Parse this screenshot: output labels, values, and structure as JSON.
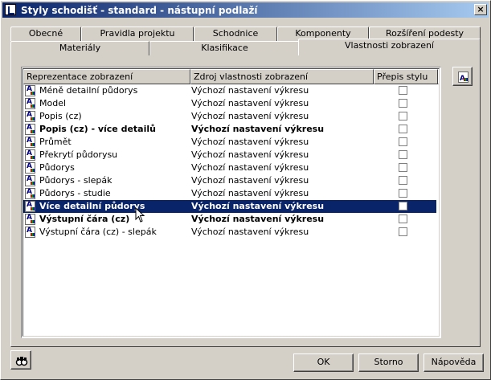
{
  "window": {
    "title": "Styly schodišť - standard - nástupní podlaží",
    "close_glyph": "×"
  },
  "tabs_back": [
    "Obecné",
    "Pravidla projektu",
    "Schodnice",
    "Komponenty",
    "Rozšíření podesty"
  ],
  "tabs_front": [
    "Materiály",
    "Klasifikace",
    "Vlastnosti zobrazení"
  ],
  "active_tab": "Vlastnosti zobrazení",
  "table": {
    "headers": [
      "Reprezentace zobrazení",
      "Zdroj vlastnosti zobrazení",
      "Přepis stylu"
    ],
    "rows": [
      {
        "name": "Méně detailní půdorys",
        "source": "Výchozí nastavení výkresu",
        "bold": false,
        "selected": false
      },
      {
        "name": "Model",
        "source": "Výchozí nastavení výkresu",
        "bold": false,
        "selected": false
      },
      {
        "name": "Popis (cz)",
        "source": "Výchozí nastavení výkresu",
        "bold": false,
        "selected": false
      },
      {
        "name": "Popis (cz) - více detailů",
        "source": "Výchozí nastavení výkresu",
        "bold": true,
        "selected": false
      },
      {
        "name": "Průmět",
        "source": "Výchozí nastavení výkresu",
        "bold": false,
        "selected": false
      },
      {
        "name": "Překrytí půdorysu",
        "source": "Výchozí nastavení výkresu",
        "bold": false,
        "selected": false
      },
      {
        "name": "Půdorys",
        "source": "Výchozí nastavení výkresu",
        "bold": false,
        "selected": false
      },
      {
        "name": "Půdorys - slepák",
        "source": "Výchozí nastavení výkresu",
        "bold": false,
        "selected": false
      },
      {
        "name": "Půdorys - studie",
        "source": "Výchozí nastavení výkresu",
        "bold": false,
        "selected": false
      },
      {
        "name": "Více detailní půdorys",
        "source": "Výchozí nastavení výkresu",
        "bold": true,
        "selected": true
      },
      {
        "name": "Výstupní čára (cz)",
        "source": "Výchozí nastavení výkresu",
        "bold": true,
        "selected": false
      },
      {
        "name": "Výstupní čára (cz) - slepák",
        "source": "Výchozí nastavení výkresu",
        "bold": false,
        "selected": false
      }
    ]
  },
  "buttons": {
    "ok": "OK",
    "cancel": "Storno",
    "help": "Nápověda"
  },
  "colors": {
    "title_start": "#0a246a",
    "title_end": "#a6caf0",
    "selection": "#0a246a",
    "face": "#d4d0c8"
  }
}
